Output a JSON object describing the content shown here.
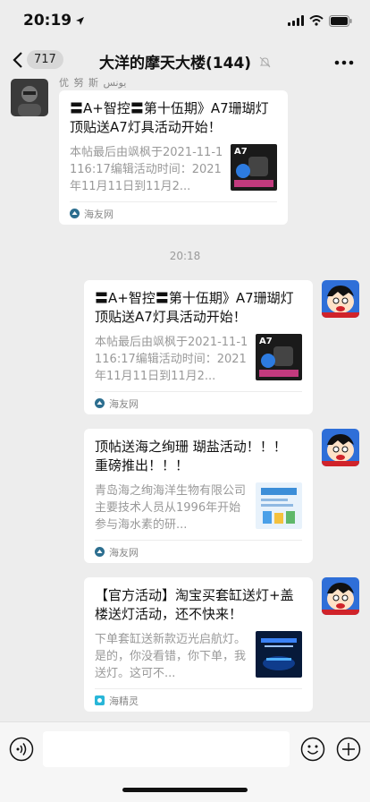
{
  "status": {
    "time": "20:19"
  },
  "nav": {
    "unread_count": "717",
    "title": "大洋的摩天大楼(144)"
  },
  "timestamp": "20:18",
  "messages": [
    {
      "sender": "优 努 斯  يونس",
      "title": "〓A+智控〓第十伍期》A7珊瑚灯顶贴送A7灯具活动开始！",
      "desc": "本帖最后由飒枫于2021-11-1116:17编辑活动时间：2021年11月11日到11月2...",
      "source": "海友网",
      "thumb_text": "A7"
    },
    {
      "title": "〓A+智控〓第十伍期》A7珊瑚灯顶贴送A7灯具活动开始！",
      "desc": "本帖最后由飒枫于2021-11-1116:17编辑活动时间：2021年11月11日到11月2...",
      "source": "海友网",
      "thumb_text": "A7"
    },
    {
      "title": "顶帖送海之绚珊 瑚盐活动！！！ 重磅推出！！！",
      "desc": "青岛海之绚海洋生物有限公司主要技术人员从1996年开始参与海水素的研...",
      "source": "海友网"
    },
    {
      "title": "【官方活动】淘宝买套缸送灯+盖楼送灯活动，还不快来！",
      "desc": "下单套缸送新款迈光启航灯。是的，你没看错，你下单，我送灯。这可不...",
      "source": "海精灵"
    }
  ],
  "colors": {
    "background": "#ededed",
    "card": "#ffffff",
    "secondary_text": "#999999"
  }
}
